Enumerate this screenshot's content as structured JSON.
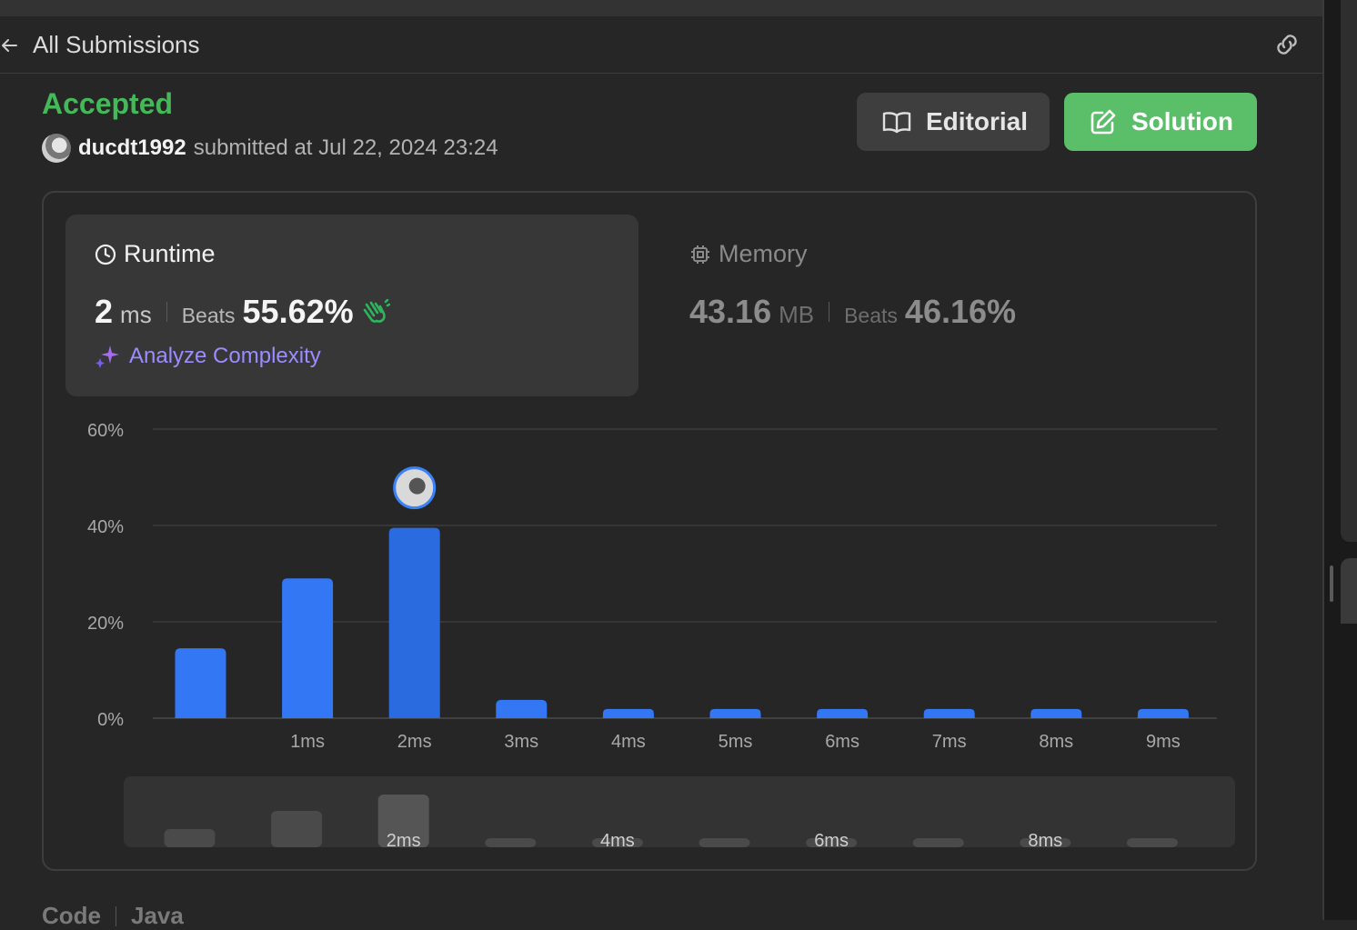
{
  "header": {
    "title": "All Submissions"
  },
  "submission": {
    "status": "Accepted",
    "username": "ducdt1992",
    "submitted_text": "submitted at Jul 22, 2024 23:24"
  },
  "buttons": {
    "editorial": "Editorial",
    "solution": "Solution"
  },
  "runtime": {
    "title": "Runtime",
    "value": "2",
    "unit": "ms",
    "beats_label": "Beats",
    "beats_value": "55.62%",
    "analyze_label": "Analyze Complexity"
  },
  "memory": {
    "title": "Memory",
    "value": "43.16",
    "unit": "MB",
    "beats_label": "Beats",
    "beats_value": "46.16%"
  },
  "colors": {
    "accepted": "#45b859",
    "bar": "#3377f5",
    "bar_selected": "#2b6be0",
    "solution_button": "#5bbf6a",
    "analyze": "#9c8cff"
  },
  "chart_data": {
    "type": "bar",
    "categories": [
      "",
      "1ms",
      "2ms",
      "3ms",
      "4ms",
      "5ms",
      "6ms",
      "7ms",
      "8ms",
      "9ms"
    ],
    "values": [
      14.5,
      29,
      39.5,
      3.8,
      1.9,
      1.9,
      1.9,
      1.9,
      1.9,
      1.9
    ],
    "ylim": [
      0,
      60
    ],
    "yticks": [
      "0%",
      "20%",
      "40%",
      "60%"
    ],
    "highlight_category": "2ms",
    "grid": true,
    "overview_labels": [
      "2ms",
      "4ms",
      "6ms",
      "8ms"
    ],
    "overview_values": [
      5,
      10,
      14.5,
      2,
      2,
      2,
      2,
      2,
      2,
      2
    ]
  },
  "code_section": {
    "label": "Code",
    "language": "Java"
  }
}
